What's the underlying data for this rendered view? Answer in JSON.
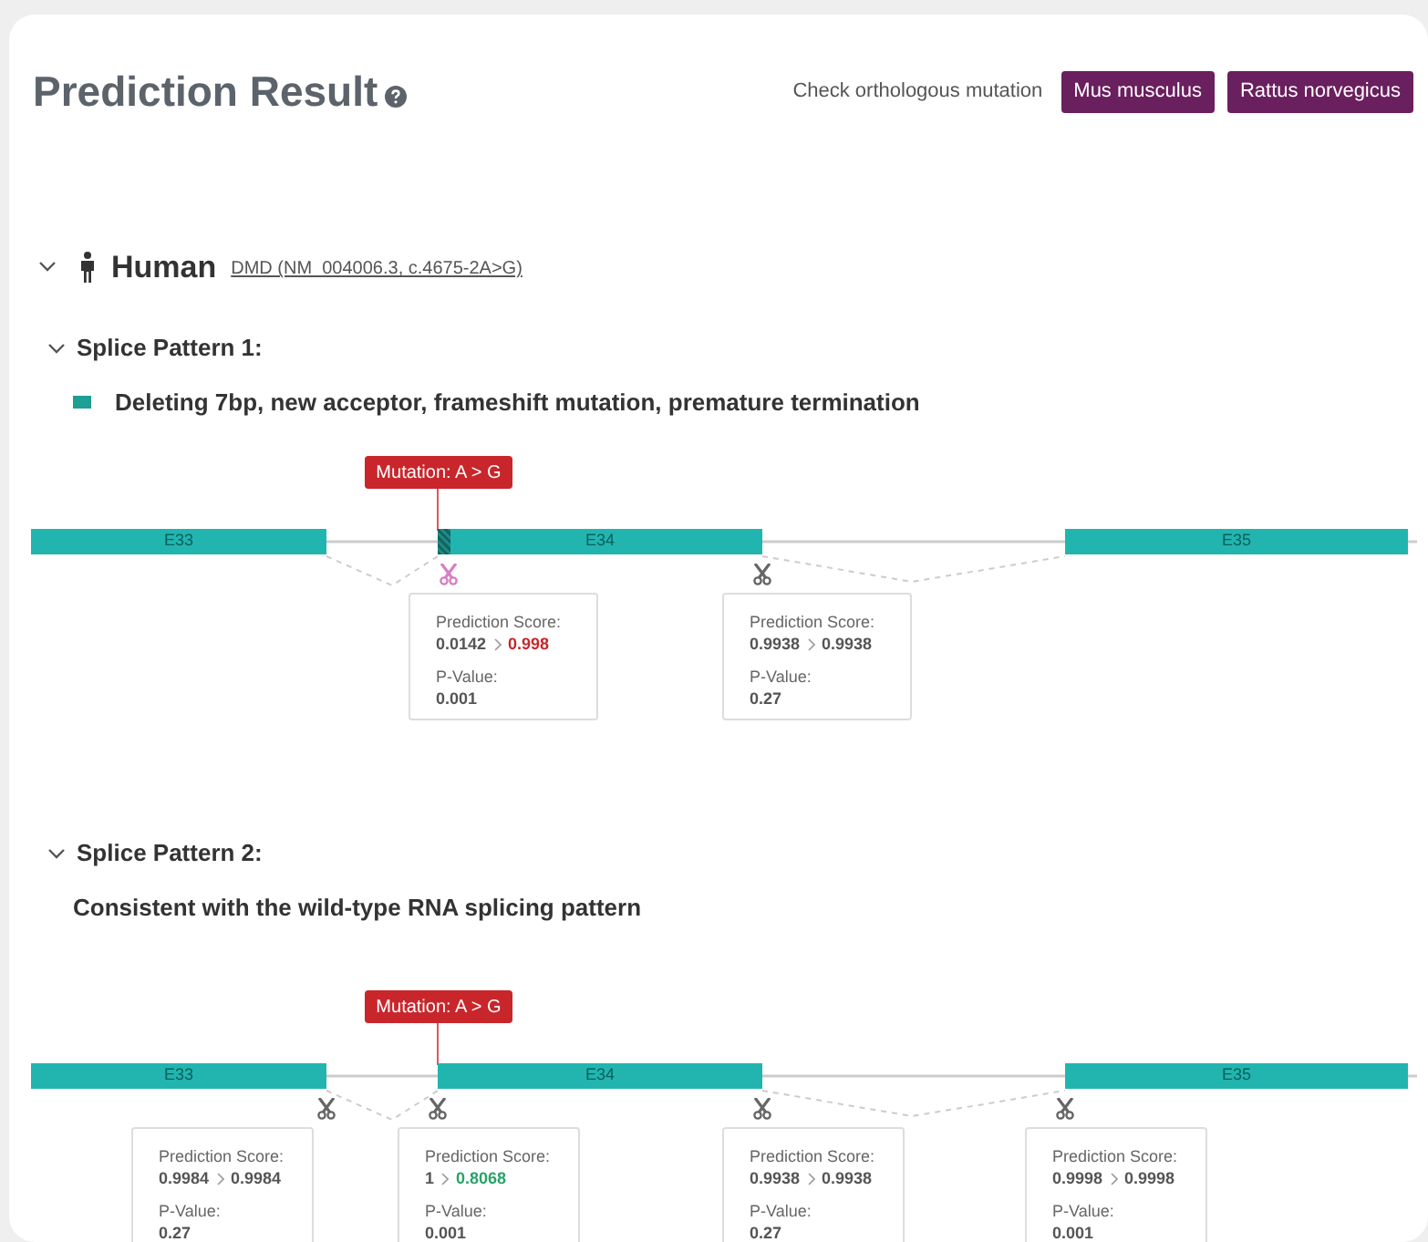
{
  "title": "Prediction Result",
  "ortholog": {
    "label": "Check orthologous mutation",
    "buttons": [
      "Mus musculus",
      "Rattus norvegicus"
    ]
  },
  "species": {
    "name": "Human",
    "expanded": true,
    "link": "DMD (NM_004006.3, c.4675-2A>G)"
  },
  "patterns": [
    {
      "title": "Splice Pattern 1:",
      "expanded": true,
      "legend": true,
      "description": "Deleting 7bp, new acceptor, frameshift mutation, premature termination",
      "mutation_label": "Mutation: A > G",
      "exons": [
        "E33",
        "E34",
        "E35"
      ],
      "sites": [
        {
          "novel": true,
          "score_label": "Prediction Score:",
          "from": "0.0142",
          "to": "0.998",
          "color": "#c8262b",
          "pvalue_label": "P-Value:",
          "pvalue": "0.001"
        },
        {
          "novel": false,
          "score_label": "Prediction Score:",
          "from": "0.9938",
          "to": "0.9938",
          "color": "#555555",
          "pvalue_label": "P-Value:",
          "pvalue": "0.27"
        }
      ]
    },
    {
      "title": "Splice Pattern 2:",
      "expanded": true,
      "legend": false,
      "description": "Consistent with the wild-type RNA splicing pattern",
      "mutation_label": "Mutation: A > G",
      "exons": [
        "E33",
        "E34",
        "E35"
      ],
      "sites": [
        {
          "novel": false,
          "score_label": "Prediction Score:",
          "from": "0.9984",
          "to": "0.9984",
          "color": "#555555",
          "pvalue_label": "P-Value:",
          "pvalue": "0.27"
        },
        {
          "novel": false,
          "score_label": "Prediction Score:",
          "from": "1",
          "to": "0.8068",
          "color": "#2aa26a",
          "pvalue_label": "P-Value:",
          "pvalue": "0.001"
        },
        {
          "novel": false,
          "score_label": "Prediction Score:",
          "from": "0.9938",
          "to": "0.9938",
          "color": "#555555",
          "pvalue_label": "P-Value:",
          "pvalue": "0.27"
        },
        {
          "novel": false,
          "score_label": "Prediction Score:",
          "from": "0.9998",
          "to": "0.9998",
          "color": "#555555",
          "pvalue_label": "P-Value:",
          "pvalue": "0.001"
        }
      ]
    }
  ]
}
